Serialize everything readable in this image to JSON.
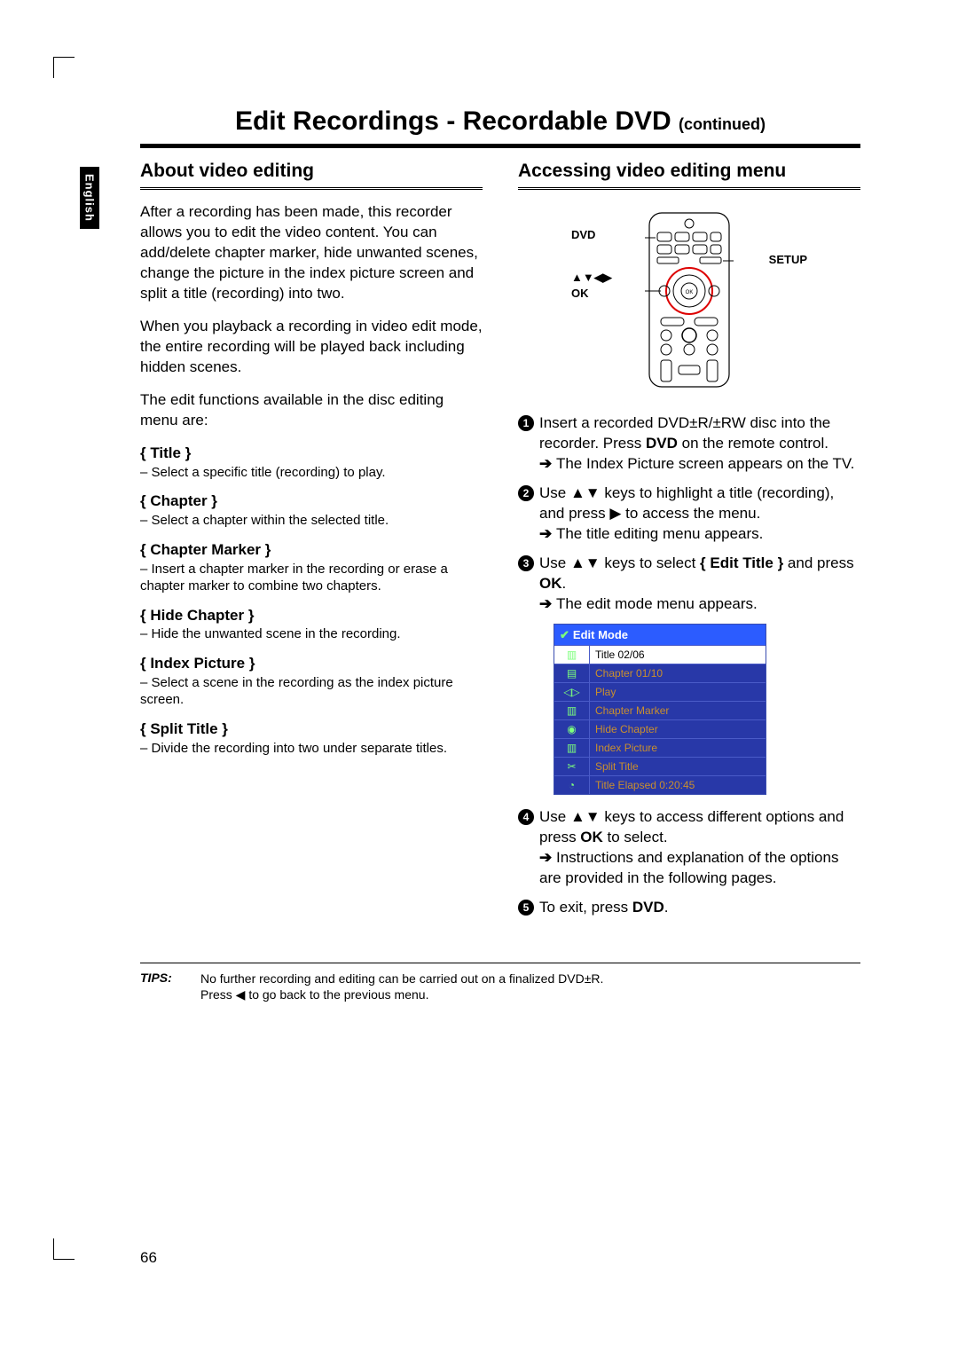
{
  "language_tab": "English",
  "page_title": "Edit Recordings - Recordable DVD",
  "page_title_suffix": "(continued)",
  "page_number": "66",
  "left": {
    "heading": "About video editing",
    "intro1": "After a recording has been made, this recorder allows you to edit the video content. You can add/delete chapter marker, hide unwanted scenes, change the picture in the index picture screen and split a title (recording) into two.",
    "intro2": "When you playback a recording in video edit mode, the entire recording will be played back including hidden scenes.",
    "intro3": "The edit functions available in the disc editing menu are:",
    "functions": [
      {
        "name": "{ Title }",
        "desc": "– Select a specific title (recording) to play."
      },
      {
        "name": "{ Chapter }",
        "desc": "– Select a chapter within the selected title."
      },
      {
        "name": "{ Chapter Marker }",
        "desc": "– Insert a chapter marker in the recording or erase a chapter marker to combine two chapters."
      },
      {
        "name": "{ Hide Chapter }",
        "desc": "– Hide the unwanted scene in the recording."
      },
      {
        "name": "{ Index Picture }",
        "desc": "– Select a scene in the recording as the index picture screen."
      },
      {
        "name": "{ Split Title }",
        "desc": "– Divide the recording into two under separate titles."
      }
    ]
  },
  "right": {
    "heading": "Accessing video editing menu",
    "remote_labels": {
      "dvd": "DVD",
      "nav": "▲▼◀▶",
      "ok": "OK",
      "setup": "SETUP"
    },
    "steps": {
      "s1a": "Insert a recorded DVD±R/±RW disc into the recorder. Press ",
      "s1b": "DVD",
      "s1c": " on the remote control.",
      "s1r": "The Index Picture screen appears on the TV.",
      "s2a": "Use ▲▼ keys to highlight a title (recording), and press ▶ to access the menu.",
      "s2r": "The title editing menu appears.",
      "s3a": "Use ▲▼ keys to select ",
      "s3b": "{ Edit Title }",
      "s3c": " and press ",
      "s3d": "OK",
      "s3e": ".",
      "s3r": "The edit mode menu appears.",
      "s4a": "Use ▲▼ keys to access different options and press ",
      "s4b": "OK",
      "s4c": " to select.",
      "s4r": "Instructions and explanation of the options are provided in the following pages.",
      "s5a": "To exit, press ",
      "s5b": "DVD",
      "s5c": "."
    },
    "edit_menu": {
      "header": "Edit Mode",
      "rows": [
        {
          "icon": "▥",
          "label": "Title 02/06",
          "title": true
        },
        {
          "icon": "▤",
          "label": "Chapter 01/10"
        },
        {
          "icon": "◁▷",
          "label": "Play"
        },
        {
          "icon": "▥",
          "label": "Chapter Marker"
        },
        {
          "icon": "◉",
          "label": "Hide Chapter"
        },
        {
          "icon": "▥",
          "label": "Index Picture"
        },
        {
          "icon": "✂",
          "label": "Split Title"
        },
        {
          "icon": "◔",
          "label": "Title Elapsed 0:20:45"
        }
      ]
    }
  },
  "tips": {
    "label": "TIPS:",
    "line1": "No further recording and editing can be carried out on a finalized DVD±R.",
    "line2": "Press ◀ to go back to the previous menu."
  }
}
